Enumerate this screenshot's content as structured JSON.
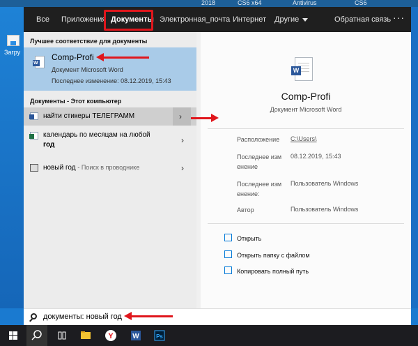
{
  "desktop": {
    "top_labels": [
      "2018",
      "CS6 x64",
      "Antivirus",
      "CS6"
    ],
    "left_icon_label": "Загру"
  },
  "tabs": [
    {
      "label": "Все"
    },
    {
      "label": "Приложения"
    },
    {
      "label": "Документы"
    },
    {
      "label": "Электронная_почта"
    },
    {
      "label": "Интернет"
    },
    {
      "label": "Другие"
    },
    {
      "label": "Обратная связь"
    }
  ],
  "more_label": "···",
  "best_match": {
    "header": "Лучшее соответствие для документы",
    "title": "Comp-Profi",
    "type": "Документ Microsoft Word",
    "modified": "Последнее изменение: 08.12.2019, 15:43"
  },
  "documents_section": {
    "header": "Документы - Этот компьютер",
    "items": [
      {
        "line1": "найти стикеры ТЕЛЕГРАММ",
        "line2": "",
        "hint": "",
        "icon": "word-doc-icon"
      },
      {
        "line1": "календарь по месяцам на любой",
        "line2": "год",
        "hint": "",
        "icon": "excel-doc-icon"
      },
      {
        "line1": "новый год",
        "line2": "",
        "hint": "- Поиск в проводнике",
        "icon": "folder-icon"
      }
    ]
  },
  "detail": {
    "title": "Comp-Profi",
    "type": "Документ Microsoft Word",
    "meta": [
      {
        "label": "Расположение",
        "value": "C:\\Users\\"
      },
      {
        "label": "Последнее изм\nенение",
        "value": "08.12.2019, 15:43"
      },
      {
        "label": "Последнее изм\nенение:",
        "value": "Пользователь Windows"
      },
      {
        "label": "Автор",
        "value": "Пользователь Windows"
      }
    ],
    "actions": [
      {
        "label": "Открыть",
        "icon": "open-icon"
      },
      {
        "label": "Открыть папку с файлом",
        "icon": "folder-open-icon"
      },
      {
        "label": "Копировать полный путь",
        "icon": "copy-icon"
      }
    ]
  },
  "search": {
    "query": "документы: новый год"
  },
  "taskbar": {
    "items": [
      "windows-start-icon",
      "search-icon",
      "task-view-icon",
      "file-explorer-icon",
      "yandex-browser-icon",
      "word-icon",
      "photoshop-icon"
    ],
    "ps_label": "Ps",
    "word_label": "W",
    "yandex_label": "Y"
  },
  "colors": {
    "highlight_red": "#e0161c",
    "selection_blue": "#a9cbe8",
    "topbar": "#1f1f1f",
    "word_blue": "#2b579a",
    "excel_green": "#1e7145",
    "link_blue": "#0078d7"
  }
}
